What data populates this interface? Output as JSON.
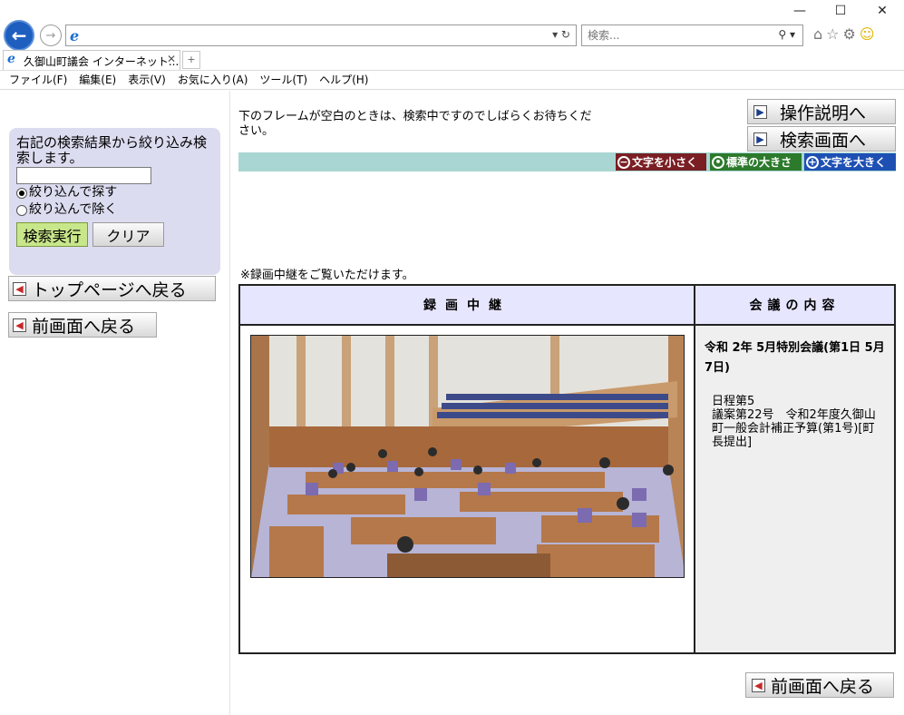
{
  "browser": {
    "search_placeholder": "検索...",
    "tab_title": "久御山町議会 インターネット...",
    "menu": [
      "ファイル(F)",
      "編集(E)",
      "表示(V)",
      "お気に入り(A)",
      "ツール(T)",
      "ヘルプ(H)"
    ]
  },
  "left": {
    "filter_description": "右記の検索結果から絞り込み検索します。",
    "filter_input_value": "",
    "radio_include": "絞り込んで探す",
    "radio_exclude": "絞り込んで除く",
    "search_button": "検索実行",
    "clear_button": "クリア",
    "top_page_button": "トップページへ戻る",
    "prev_page_button": "前画面へ戻る"
  },
  "right": {
    "help_button": "操作説明へ",
    "search_screen_button": "検索画面へ",
    "notice": "下のフレームが空白のときは、検索中ですのでしばらくお待ちください。",
    "font_small": "文字を小さく",
    "font_standard": "標準の大きさ",
    "font_large": "文字を大きく",
    "caption": "※録画中継をご覧いただけます。",
    "header_video": "録画中継",
    "header_content": "会議の内容",
    "meeting_title": "令和 2年 5月特別会議(第1日 5月 7日)",
    "agenda_line1": "日程第5",
    "agenda_line2": "議案第22号　令和2年度久御山町一般会計補正予算(第1号)[町長提出]",
    "prev_page_button_bottom": "前画面へ戻る"
  }
}
